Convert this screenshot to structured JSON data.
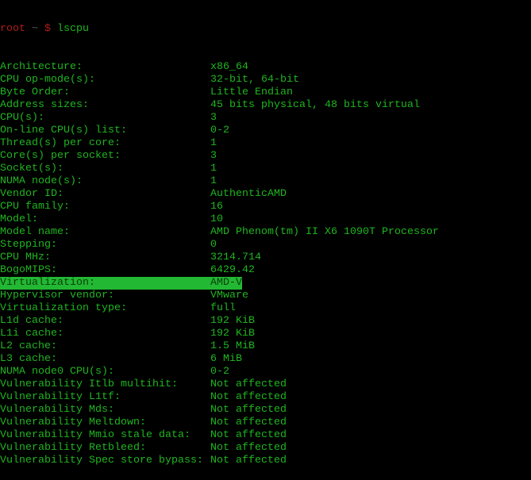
{
  "terminal": {
    "prompt": {
      "user": "root",
      "tilde": "~",
      "dollar": "$",
      "command": "lscpu"
    },
    "colors": {
      "text": "#1fb51f",
      "prompt_red": "#b01c1c",
      "highlight_bg": "#22b833",
      "highlight_text": "#0b3d0b",
      "background": "#000000"
    },
    "rows": [
      {
        "label": "Architecture:",
        "value": "x86_64"
      },
      {
        "label": "CPU op-mode(s):",
        "value": "32-bit, 64-bit"
      },
      {
        "label": "Byte Order:",
        "value": "Little Endian"
      },
      {
        "label": "Address sizes:",
        "value": "45 bits physical, 48 bits virtual"
      },
      {
        "label": "CPU(s):",
        "value": "3"
      },
      {
        "label": "On-line CPU(s) list:",
        "value": "0-2"
      },
      {
        "label": "Thread(s) per core:",
        "value": "1"
      },
      {
        "label": "Core(s) per socket:",
        "value": "3"
      },
      {
        "label": "Socket(s):",
        "value": "1"
      },
      {
        "label": "NUMA node(s):",
        "value": "1"
      },
      {
        "label": "Vendor ID:",
        "value": "AuthenticAMD"
      },
      {
        "label": "CPU family:",
        "value": "16"
      },
      {
        "label": "Model:",
        "value": "10"
      },
      {
        "label": "Model name:",
        "value": "AMD Phenom(tm) II X6 1090T Processor"
      },
      {
        "label": "Stepping:",
        "value": "0"
      },
      {
        "label": "CPU MHz:",
        "value": "3214.714"
      },
      {
        "label": "BogoMIPS:",
        "value": "6429.42"
      },
      {
        "label": "Virtualization:",
        "value": "AMD-V",
        "highlighted": true
      },
      {
        "label": "Hypervisor vendor:",
        "value": "VMware"
      },
      {
        "label": "Virtualization type:",
        "value": "full"
      },
      {
        "label": "L1d cache:",
        "value": "192 KiB"
      },
      {
        "label": "L1i cache:",
        "value": "192 KiB"
      },
      {
        "label": "L2 cache:",
        "value": "1.5 MiB"
      },
      {
        "label": "L3 cache:",
        "value": "6 MiB"
      },
      {
        "label": "NUMA node0 CPU(s):",
        "value": "0-2"
      },
      {
        "label": "Vulnerability Itlb multihit:",
        "value": "Not affected"
      },
      {
        "label": "Vulnerability L1tf:",
        "value": "Not affected"
      },
      {
        "label": "Vulnerability Mds:",
        "value": "Not affected"
      },
      {
        "label": "Vulnerability Meltdown:",
        "value": "Not affected"
      },
      {
        "label": "Vulnerability Mmio stale data:",
        "value": "Not affected"
      },
      {
        "label": "Vulnerability Retbleed:",
        "value": "Not affected"
      },
      {
        "label": "Vulnerability Spec store bypass:",
        "value": "Not affected"
      }
    ]
  }
}
